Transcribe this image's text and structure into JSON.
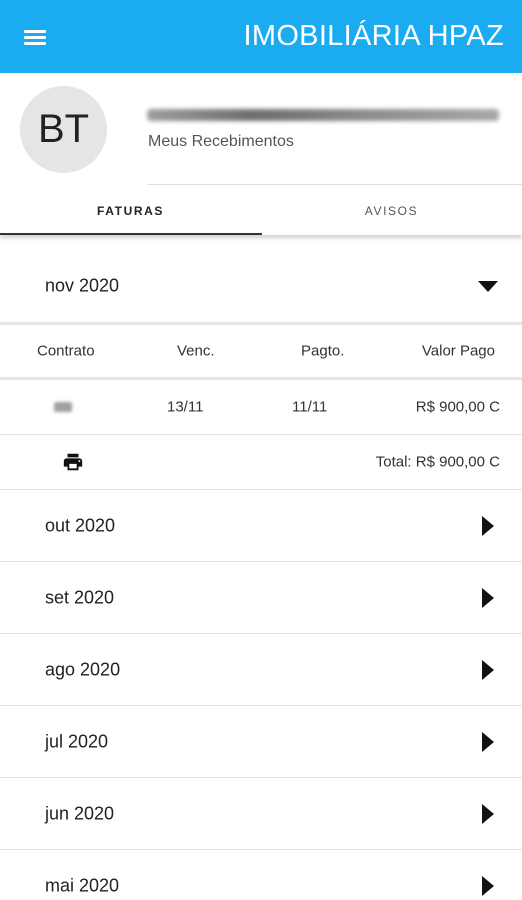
{
  "appbar": {
    "title": "IMOBILIÁRIA HPAZ",
    "menu_icon": "menu-icon",
    "color": "#1aabf0"
  },
  "profile": {
    "initials": "BT",
    "subtitle": "Meus Recebimentos"
  },
  "tabs": [
    {
      "label": "FATURAS",
      "active": true
    },
    {
      "label": "AVISOS",
      "active": false
    }
  ],
  "expanded": {
    "month": "nov 2020",
    "icon": "triangle-down-icon",
    "columns": [
      "Contrato",
      "Venc.",
      "Pagto.",
      "Valor Pago"
    ],
    "rows": [
      {
        "venc": "13/11",
        "pagto": "11/11",
        "valor": "R$ 900,00 C"
      }
    ],
    "print_icon": "print-icon",
    "total": "Total: R$ 900,00 C"
  },
  "months": [
    {
      "label": "out 2020",
      "icon": "triangle-right-icon"
    },
    {
      "label": "set 2020",
      "icon": "triangle-right-icon"
    },
    {
      "label": "ago 2020",
      "icon": "triangle-right-icon"
    },
    {
      "label": "jul 2020",
      "icon": "triangle-right-icon"
    },
    {
      "label": "jun 2020",
      "icon": "triangle-right-icon"
    },
    {
      "label": "mai 2020",
      "icon": "triangle-right-icon"
    }
  ]
}
